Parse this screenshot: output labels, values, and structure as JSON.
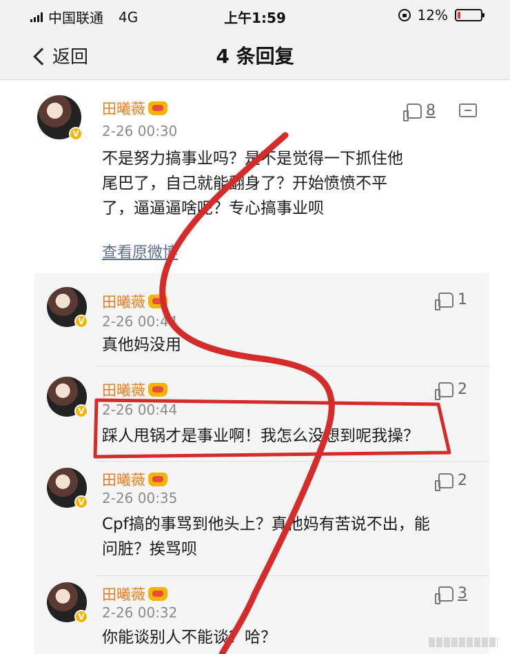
{
  "status": {
    "carrier": "中国联通",
    "network": "4G",
    "time": "上午1:59",
    "battery": "12%",
    "battery_level": 0.12,
    "battery_color": "#e53935"
  },
  "nav": {
    "back_label": "返回",
    "title": "4 条回复"
  },
  "main_comment": {
    "username": "田曦薇",
    "timestamp": "2-26 00:30",
    "likes": "8",
    "lines": [
      "不是努力搞事业吗？是不是觉得一下抓住他",
      "尾巴了，自己就能翻身了？开始愤愤不平",
      "了，逼逼逼啥呢？专心搞事业呗"
    ],
    "view_original": "查看原微博"
  },
  "replies": [
    {
      "username": "田曦薇",
      "timestamp": "2-26 00:44",
      "likes": "1",
      "lines": [
        "真他妈没用"
      ]
    },
    {
      "username": "田曦薇",
      "timestamp": "2-26 00:44",
      "likes": "2",
      "lines": [
        "踩人甩锅才是事业啊！我怎么没想到呢我操？"
      ]
    },
    {
      "username": "田曦薇",
      "timestamp": "2-26 00:35",
      "likes": "2",
      "lines": [
        "Cpf搞的事骂到他头上？真他妈有苦说不出，能",
        "问脏？挨骂呗"
      ]
    },
    {
      "username": "田曦薇",
      "timestamp": "2-26 00:32",
      "likes": "3",
      "lines": [
        "你能谈别人不能谈？哈？"
      ]
    }
  ],
  "colors": {
    "username": "#e67e22",
    "annotation": "#d42b2b",
    "link": "#5b6d8f"
  },
  "icons": [
    "signal-icon",
    "rotation-lock-icon",
    "battery-icon",
    "back-chevron-icon",
    "thumbs-up-icon",
    "comment-icon",
    "crown-badge-icon",
    "verified-icon"
  ]
}
